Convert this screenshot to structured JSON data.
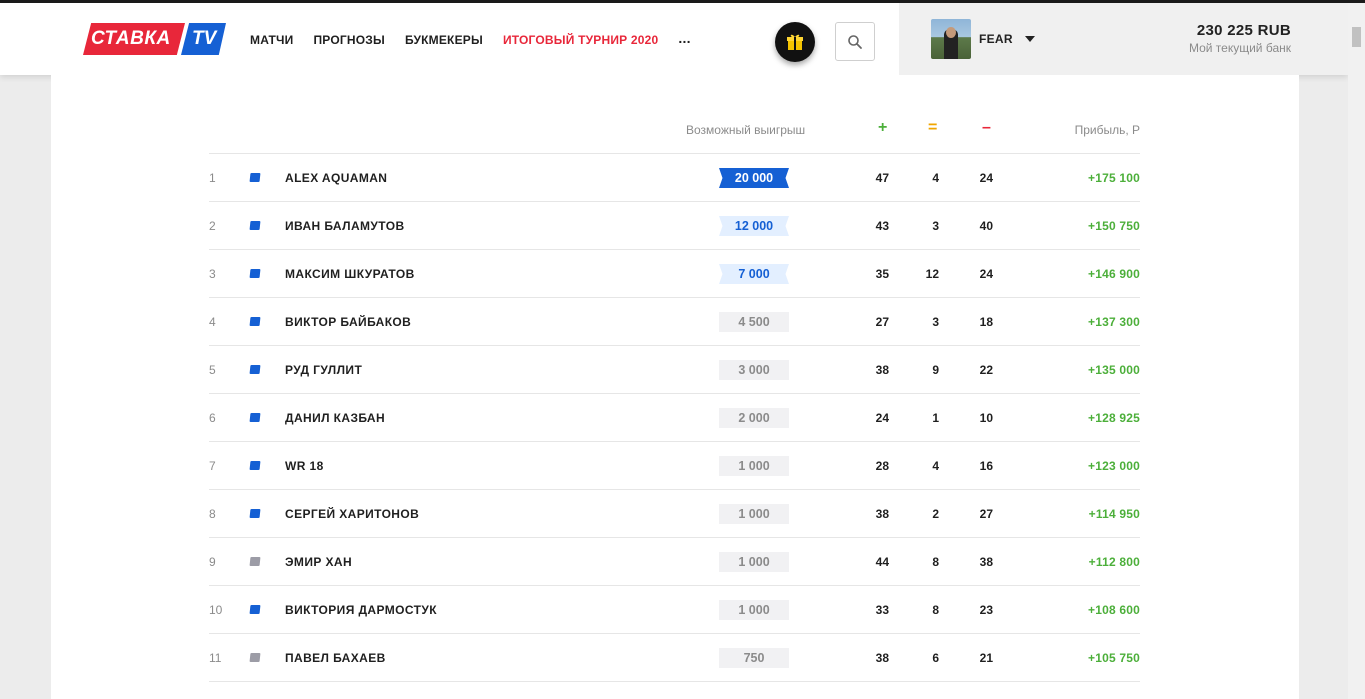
{
  "header": {
    "logo": {
      "part_a": "СТАВКА",
      "part_b": "TV"
    },
    "nav": [
      {
        "label": "МАТЧИ",
        "red": false
      },
      {
        "label": "ПРОГНОЗЫ",
        "red": false
      },
      {
        "label": "БУКМЕКЕРЫ",
        "red": false
      },
      {
        "label": "ИТОГОВЫЙ ТУРНИР 2020",
        "red": true
      }
    ],
    "more": "...",
    "gift_icon": "gift-icon",
    "search_icon": "search-icon",
    "user": {
      "name": "FEAR"
    },
    "bank": {
      "amount": "230 225 RUB",
      "label": "Мой текущий банк"
    }
  },
  "colors": {
    "brand_red": "#e8273a",
    "brand_blue": "#1560d4",
    "profit_green": "#4caf3a",
    "draw_orange": "#f0a500"
  },
  "table": {
    "headers": {
      "prize": "Возможный выигрыш",
      "wins": "+",
      "draws": "=",
      "losses": "–",
      "profit": "Прибыль, Р"
    },
    "rows": [
      {
        "rank": "1",
        "flag": "blue",
        "name": "ALEX AQUAMAN",
        "prize": "20 000",
        "prize_style": "gold",
        "w": "47",
        "d": "4",
        "l": "24",
        "profit": "+175 100"
      },
      {
        "rank": "2",
        "flag": "blue",
        "name": "ИВАН БАЛАМУТОВ",
        "prize": "12 000",
        "prize_style": "light",
        "w": "43",
        "d": "3",
        "l": "40",
        "profit": "+150 750"
      },
      {
        "rank": "3",
        "flag": "blue",
        "name": "МАКСИМ ШКУРАТОВ",
        "prize": "7 000",
        "prize_style": "light",
        "w": "35",
        "d": "12",
        "l": "24",
        "profit": "+146 900"
      },
      {
        "rank": "4",
        "flag": "blue",
        "name": "ВИКТОР БАЙБАКОВ",
        "prize": "4 500",
        "prize_style": "plain",
        "w": "27",
        "d": "3",
        "l": "18",
        "profit": "+137 300"
      },
      {
        "rank": "5",
        "flag": "blue",
        "name": "РУД ГУЛЛИТ",
        "prize": "3 000",
        "prize_style": "plain",
        "w": "38",
        "d": "9",
        "l": "22",
        "profit": "+135 000"
      },
      {
        "rank": "6",
        "flag": "blue",
        "name": "ДАНИЛ КАЗБАН",
        "prize": "2 000",
        "prize_style": "plain",
        "w": "24",
        "d": "1",
        "l": "10",
        "profit": "+128 925"
      },
      {
        "rank": "7",
        "flag": "blue",
        "name": "WR 18",
        "prize": "1 000",
        "prize_style": "plain",
        "w": "28",
        "d": "4",
        "l": "16",
        "profit": "+123 000"
      },
      {
        "rank": "8",
        "flag": "blue",
        "name": "СЕРГЕЙ ХАРИТОНОВ",
        "prize": "1 000",
        "prize_style": "plain",
        "w": "38",
        "d": "2",
        "l": "27",
        "profit": "+114 950"
      },
      {
        "rank": "9",
        "flag": "grey",
        "name": "ЭМИР ХАН",
        "prize": "1 000",
        "prize_style": "plain",
        "w": "44",
        "d": "8",
        "l": "38",
        "profit": "+112 800"
      },
      {
        "rank": "10",
        "flag": "blue",
        "name": "ВИКТОРИЯ ДАРМОСТУК",
        "prize": "1 000",
        "prize_style": "plain",
        "w": "33",
        "d": "8",
        "l": "23",
        "profit": "+108 600"
      },
      {
        "rank": "11",
        "flag": "grey",
        "name": "ПАВЕЛ БАХАЕВ",
        "prize": "750",
        "prize_style": "plain",
        "w": "38",
        "d": "6",
        "l": "21",
        "profit": "+105 750"
      }
    ]
  }
}
